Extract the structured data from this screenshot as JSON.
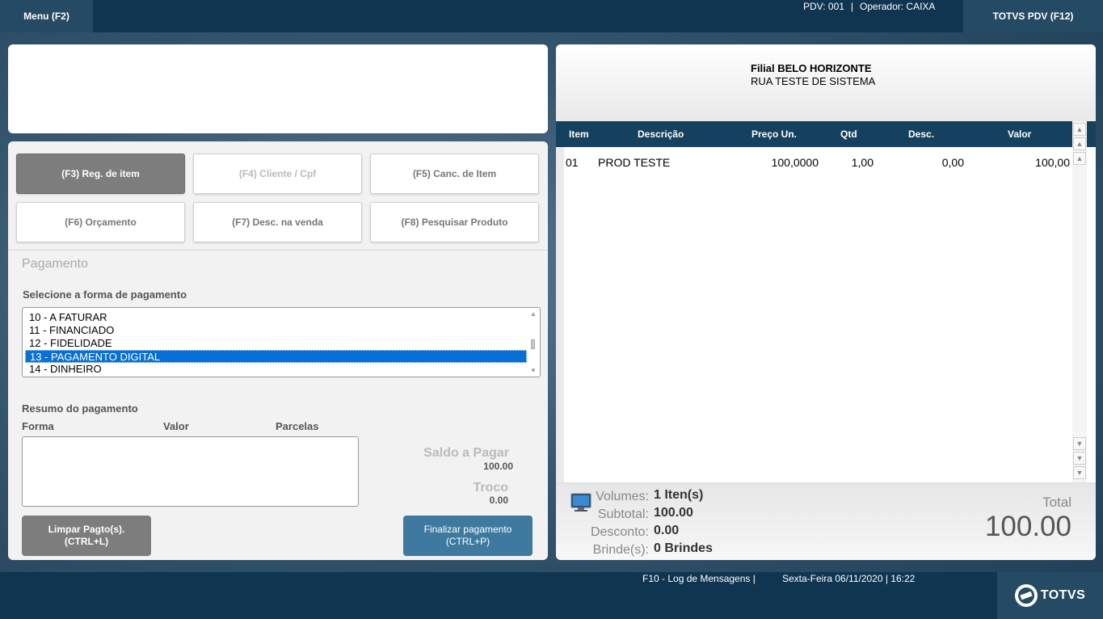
{
  "topbar": {
    "menu_label": "Menu (F2)",
    "pdv": "PDV: 001",
    "separator": "|",
    "operador": "Operador: CAIXA",
    "totvs_label": "TOTVS PDV (F12)"
  },
  "function_buttons": [
    {
      "label": "(F3) Reg. de item"
    },
    {
      "label": "(F4) Cliente / Cpf"
    },
    {
      "label": "(F5) Canc. de Item"
    },
    {
      "label": "(F6) Orçamento"
    },
    {
      "label": "(F7) Desc. na venda"
    },
    {
      "label": "(F8) Pesquisar Produto"
    }
  ],
  "payment": {
    "title": "Pagamento",
    "select_label": "Selecione a forma de pagamento",
    "options": [
      "10 - A FATURAR",
      "11 - FINANCIADO",
      "12 - FIDELIDADE",
      "13 - PAGAMENTO DIGITAL",
      "14 - DINHEIRO"
    ],
    "selected": "13 - PAGAMENTO DIGITAL",
    "summary_label": "Resumo do pagamento",
    "columns": [
      "Forma",
      "Valor",
      "Parcelas"
    ],
    "saldo_label": "Saldo a Pagar",
    "saldo_value": "100.00",
    "troco_label": "Troco",
    "troco_value": "0.00",
    "limpar_line1": "Limpar Pagto(s).",
    "limpar_line2": "(CTRL+L)",
    "finalizar_line1": "Finalizar pagamento",
    "finalizar_line2": "(CTRL+P)"
  },
  "receipt": {
    "filial": "Filial BELO HORIZONTE",
    "address": "RUA TESTE DE SISTEMA",
    "headers": [
      "Item",
      "Descrição",
      "Preço Un.",
      "Qtd",
      "Desc.",
      "Valor"
    ],
    "rows": [
      {
        "item": "01",
        "descricao": "PROD TESTE",
        "preco": "100,0000",
        "qtd": "1,00",
        "desc": "0,00",
        "valor": "100,00"
      }
    ],
    "volumes_label": "Volumes:",
    "volumes_value": "1 Iten(s)",
    "subtotal_label": "Subtotal:",
    "subtotal_value": "100.00",
    "desconto_label": "Desconto:",
    "desconto_value": "0.00",
    "brindes_label": "Brinde(s):",
    "brindes_value": "0 Brindes",
    "total_label": "Total",
    "total_value": "100.00"
  },
  "bottombar": {
    "log_text": "F10 - Log de Mensagens |",
    "date_text": "Sexta-Feira 06/11/2020 | 16:22",
    "logo_text": "TOTVS"
  },
  "colors": {
    "dark_bar": "#0f3550",
    "accent_button": "#3e7aa0",
    "selection": "#0a6fd4",
    "table_header": "#15405e"
  },
  "icons": [
    "scroll-up-icon",
    "scroll-down-icon",
    "monitor-icon",
    "totvs-logo-icon"
  ]
}
